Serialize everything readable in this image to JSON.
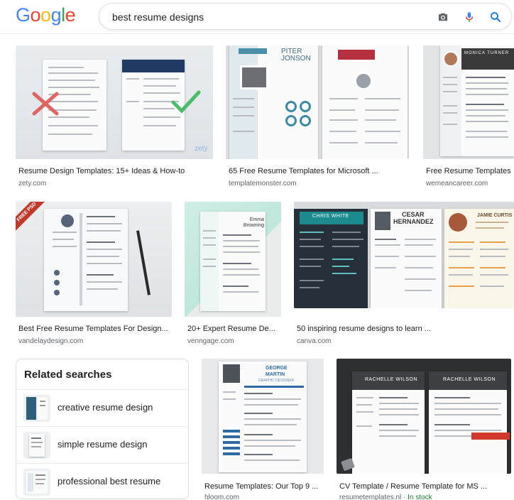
{
  "header": {
    "logo_letters": [
      "G",
      "o",
      "o",
      "g",
      "l",
      "e"
    ],
    "logo_colors": [
      "#4285F4",
      "#EA4335",
      "#FBBC05",
      "#4285F4",
      "#34A853",
      "#EA4335"
    ],
    "search_value": "best resume designs",
    "icons": [
      "camera-icon",
      "microphone-icon",
      "search-icon"
    ]
  },
  "results": [
    {
      "caption": "Resume Design Templates: 15+ Ideas & How-to",
      "source": "zety.com",
      "watermark": "zety"
    },
    {
      "caption": "65 Free Resume Templates for Microsoft ...",
      "source": "templatemonster.com",
      "name_first": "PITER",
      "name_last": "JONSON"
    },
    {
      "caption": "Free Resume Templates",
      "source": "wemeancareer.com",
      "name": "MONICA TURNER"
    },
    {
      "caption": "Best Free Resume Templates For Design...",
      "source": "vandelaydesign.com",
      "ribbon": "FREE PSD"
    },
    {
      "caption": "20+ Expert Resume De...",
      "source": "venngage.com",
      "name": "Emma Browning"
    },
    {
      "caption": "50 inspiring resume designs to learn ...",
      "source": "canva.com",
      "name1": "CHRIS WHITE",
      "name2_first": "CESAR",
      "name2_last": "HERNANDEZ",
      "name3": "JAMIE CURTIS"
    },
    {
      "caption": "Resume Templates: Our Top 9 ...",
      "source": "hloom.com",
      "name_first": "GEORGE",
      "name_last": "MARTIN",
      "subtitle": "GRAPHIC DESIGNER"
    },
    {
      "caption": "CV Template / Resume Template for MS ...",
      "source": "resumetemplates.nl",
      "stock": "In stock",
      "name": "RACHELLE WILSON"
    }
  ],
  "related": {
    "title": "Related searches",
    "items": [
      {
        "label": "creative resume design"
      },
      {
        "label": "simple resume design"
      },
      {
        "label": "professional best resume"
      }
    ]
  },
  "colors": {
    "accent": "#1a73e8",
    "caption": "#202124",
    "source": "#5f6368",
    "stock": "#188038"
  }
}
